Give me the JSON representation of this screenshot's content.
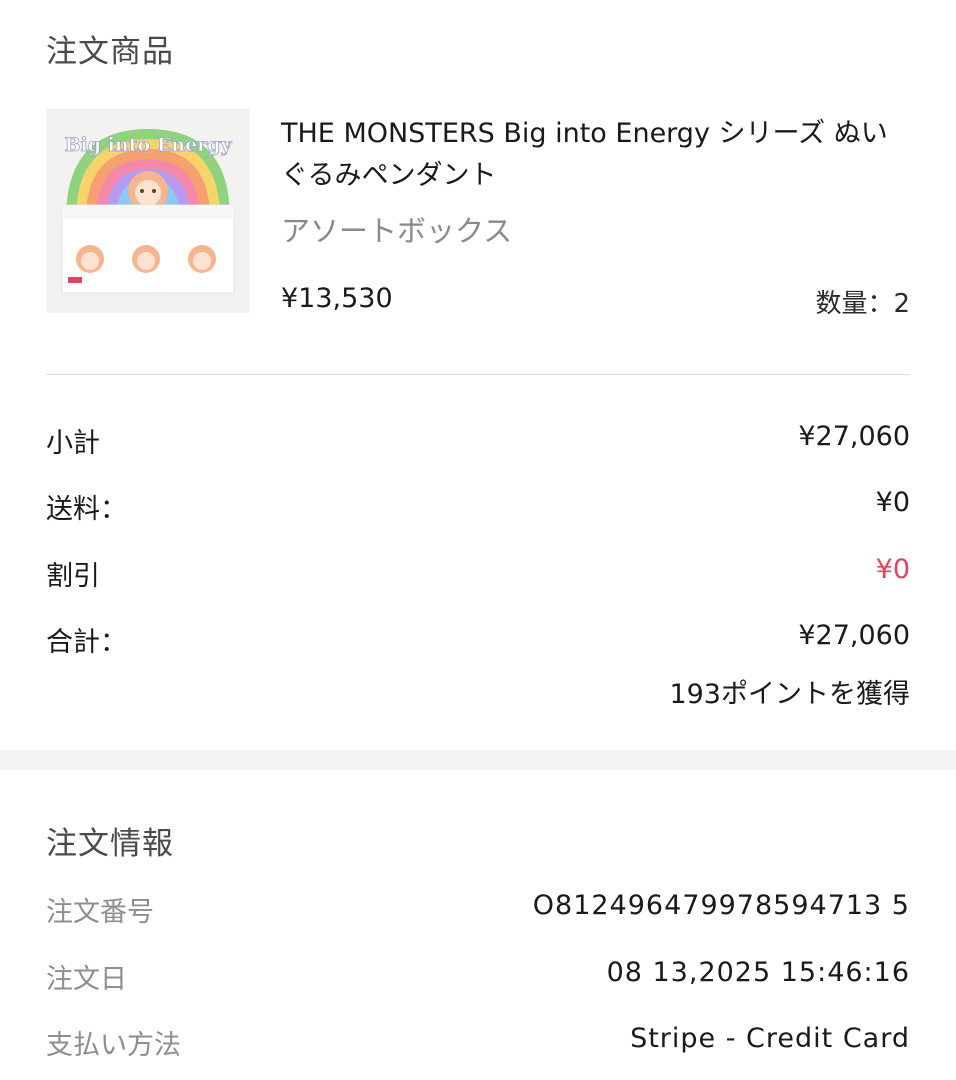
{
  "order_items": {
    "title": "注文商品",
    "product": {
      "name": "THE MONSTERS Big into Energy シリーズ ぬいぐるみペンダント",
      "variant": "アソートボックス",
      "price": "¥13,530",
      "quantity": "数量：2",
      "image_text": "Big into Energy"
    },
    "summary": {
      "subtotal_label": "小計",
      "subtotal_value": "¥27,060",
      "shipping_label": "送料：",
      "shipping_value": "¥0",
      "discount_label": "割引",
      "discount_value": "¥0",
      "total_label": "合計：",
      "total_value": "¥27,060",
      "points": "193ポイントを獲得"
    }
  },
  "order_info": {
    "title": "注文情報",
    "order_number_label": "注文番号",
    "order_number_value": "O812496479978594713 5",
    "order_date_label": "注文日",
    "order_date_value": "08 13,2025 15:46:16",
    "payment_label": "支払い方法",
    "payment_value": "Stripe - Credit Card"
  },
  "colors": {
    "discount_red": "#e2445c",
    "label_gray": "#8e8e8e",
    "divider": "#dcdcdc",
    "band": "#f4f4f4"
  }
}
